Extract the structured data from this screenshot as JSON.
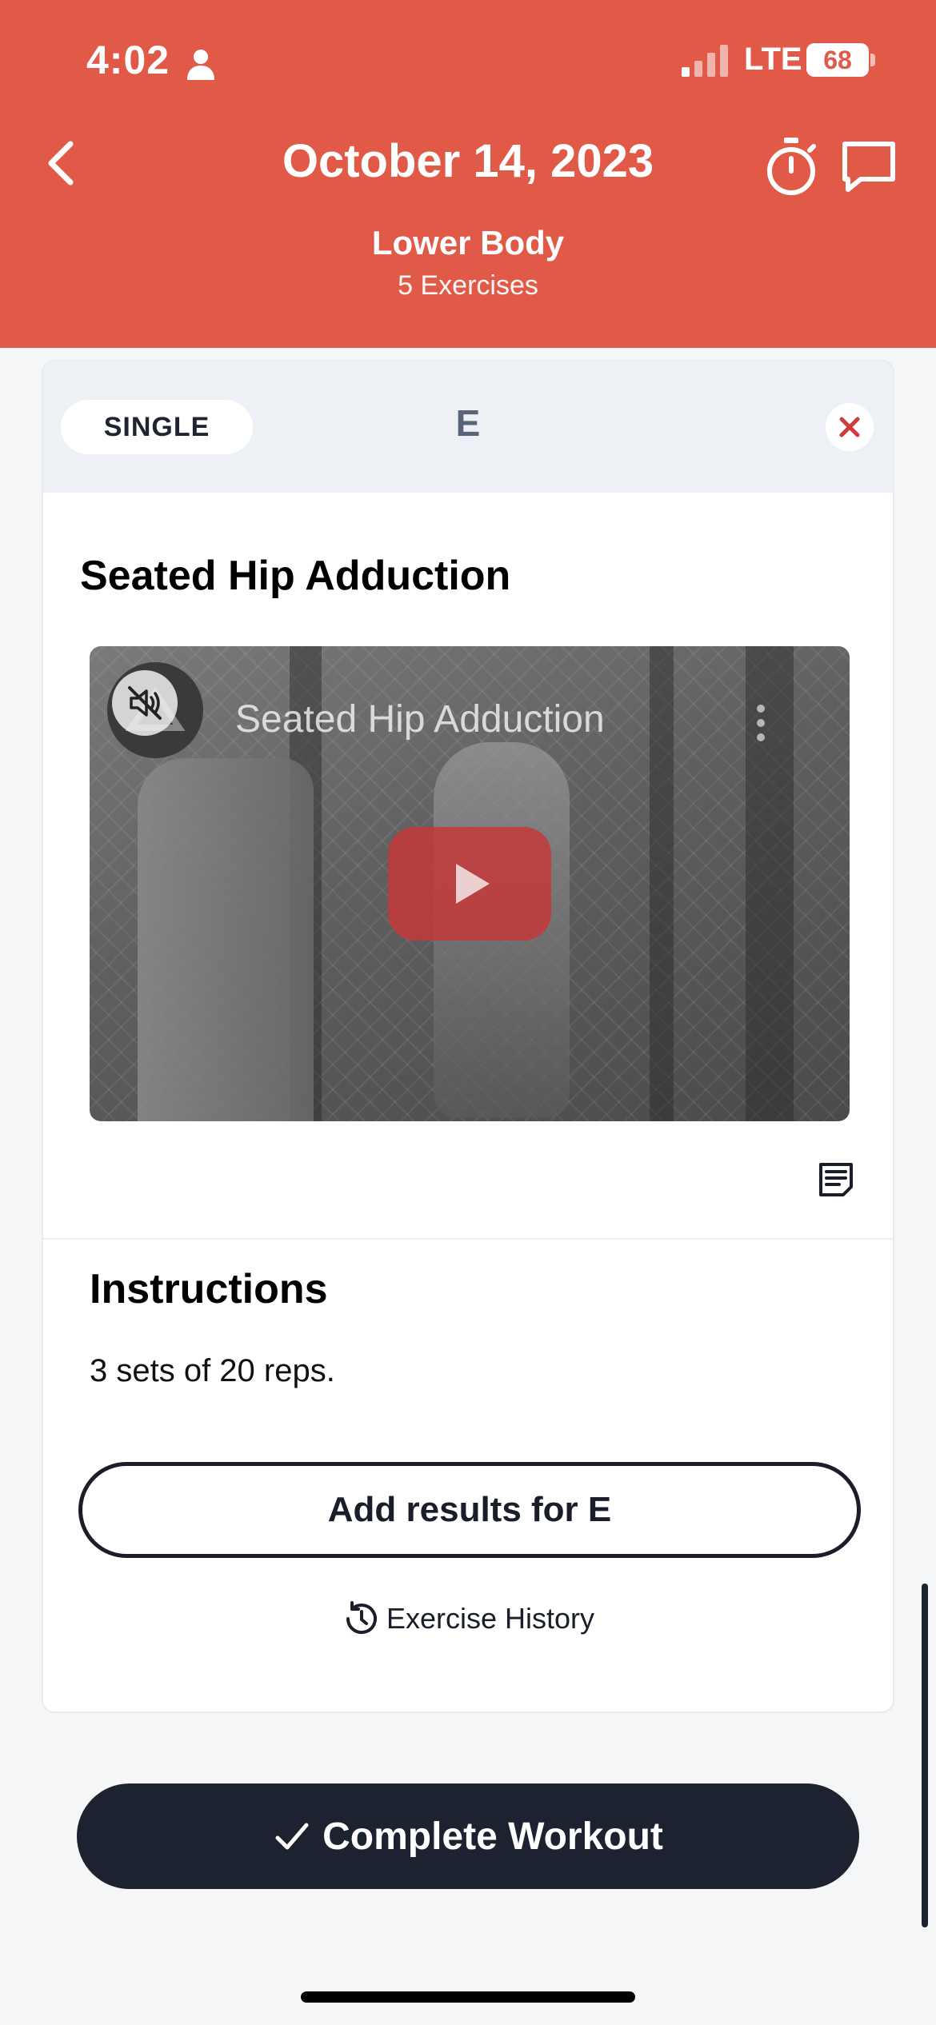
{
  "status_bar": {
    "time": "4:02",
    "network": "LTE",
    "battery": "68",
    "person_icon": "person-icon",
    "signal_icon": "cellular-signal-icon"
  },
  "header": {
    "title": "October 14, 2023",
    "workout_name": "Lower Body",
    "exercise_count": "5 Exercises",
    "background_color": "#e05a47",
    "icons": [
      "chevron-left-icon",
      "stopwatch-icon",
      "chat-icon"
    ]
  },
  "card": {
    "type_pill": "SINGLE",
    "letter": "E",
    "close_icon": "close-icon",
    "exercise_name": "Seated Hip Adduction",
    "video": {
      "title": "Seated Hip Adduction",
      "mute_icon": "muted-speaker-icon",
      "play_icon": "play-icon",
      "more_icon": "more-vertical-icon"
    },
    "notes_icon": "notes-icon",
    "instructions_heading": "Instructions",
    "instructions_text": "3 sets of 20 reps.",
    "add_results_label": "Add results for E",
    "history_label": "Exercise History",
    "history_icon": "history-clock-icon"
  },
  "footer": {
    "complete_label": "Complete Workout",
    "check_icon": "checkmark-icon",
    "button_color": "#1d2230"
  }
}
